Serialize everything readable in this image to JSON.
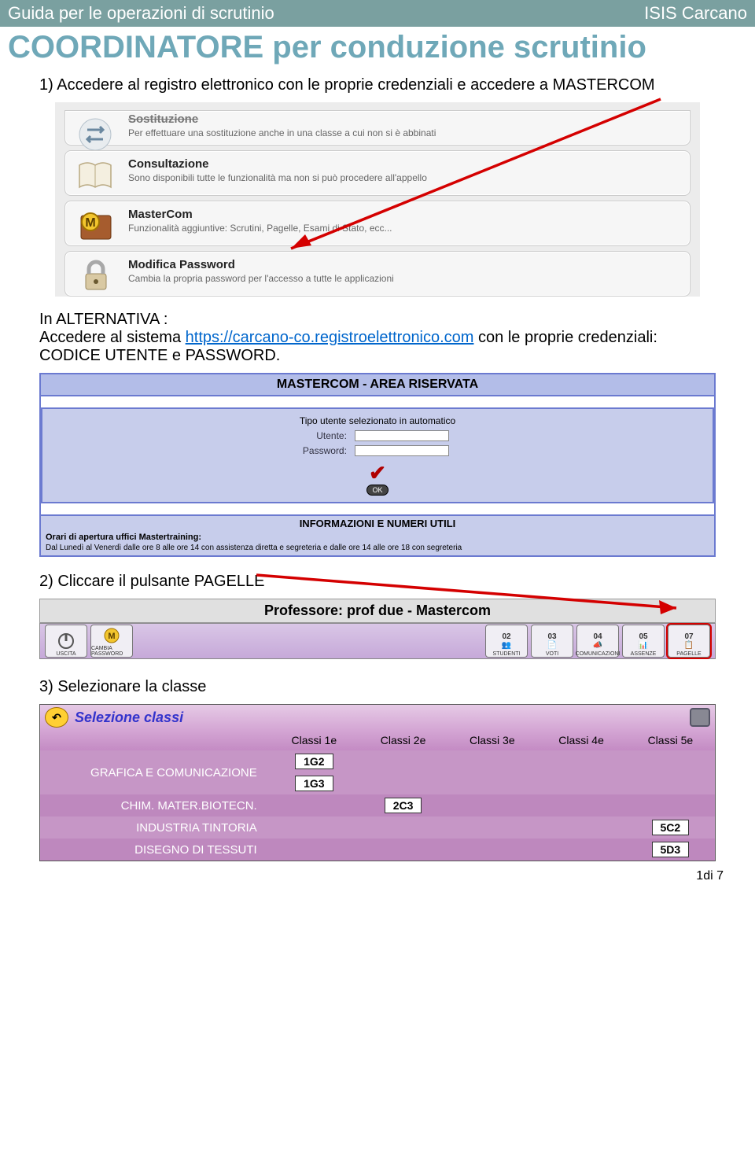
{
  "header": {
    "left": "Guida per le operazioni di scrutinio",
    "right": "ISIS Carcano"
  },
  "title": "COORDINATORE  per conduzione scrutinio",
  "step1": "1) Accedere al registro elettronico con le proprie credenziali  e accedere a MASTERCOM",
  "menu": {
    "card0": {
      "title": "Sostituzione",
      "sub": "Per effettuare una sostituzione anche in una classe a cui non si è abbinati"
    },
    "card1": {
      "title": "Consultazione",
      "sub": "Sono disponibili tutte le funzionalità ma non si può procedere all'appello"
    },
    "card2": {
      "title": "MasterCom",
      "sub": "Funzionalità aggiuntive: Scrutini, Pagelle, Esami di Stato, ecc..."
    },
    "card3": {
      "title": "Modifica Password",
      "sub": "Cambia la propria password per l'accesso a tutte le applicazioni"
    }
  },
  "alt_intro": "In ALTERNATIVA :",
  "alt_line1_a": " Accedere al sistema ",
  "alt_link": "https://carcano-co.registroelettronico.com",
  "alt_line1_b": " con le proprie credenziali: CODICE UTENTE e PASSWORD.",
  "login": {
    "header": "MASTERCOM - AREA RISERVATA",
    "auto": "Tipo utente selezionato in automatico",
    "user_lbl": "Utente:",
    "pass_lbl": "Password:",
    "ok": "OK",
    "info_hdr": "INFORMAZIONI E NUMERI UTILI",
    "orari": "Orari di apertura uffici Mastertraining:",
    "detail": "Dal Lunedì al Venerdì dalle ore 8 alle ore 14 con assistenza diretta e segreteria e dalle ore 14 alle ore 18 con segreteria"
  },
  "step2": "2) Cliccare il pulsante PAGELLE",
  "prof": {
    "header": "Professore: prof due - Mastercom",
    "btn_uscita": "USCITA",
    "btn_cambia": "CAMBIA PASSWORD",
    "btn_studenti": "STUDENTI",
    "btn_voti": "VOTI",
    "btn_comm": "COMUNICAZIONI",
    "btn_assenze": "ASSENZE",
    "btn_pagelle": "PAGELLE",
    "num02": "02",
    "num03": "03",
    "num04": "04",
    "num05": "05",
    "num07": "07"
  },
  "step3": "3) Selezionare la classe",
  "classes": {
    "title": "Selezione classi",
    "cols": {
      "c1": "Classi 1e",
      "c2": "Classi 2e",
      "c3": "Classi 3e",
      "c4": "Classi 4e",
      "c5": "Classi 5e"
    },
    "rows": {
      "r1_lbl": "GRAFICA E COMUNICAZIONE",
      "r1_b1": "1G2",
      "r1_b2": "1G3",
      "r2_lbl": "CHIM. MATER.BIOTECN.",
      "r2_b1": "2C3",
      "r3_lbl": "INDUSTRIA TINTORIA",
      "r3_b1": "5C2",
      "r4_lbl": "DISEGNO DI TESSUTI",
      "r4_b1": "5D3"
    }
  },
  "page_num": "1di 7"
}
